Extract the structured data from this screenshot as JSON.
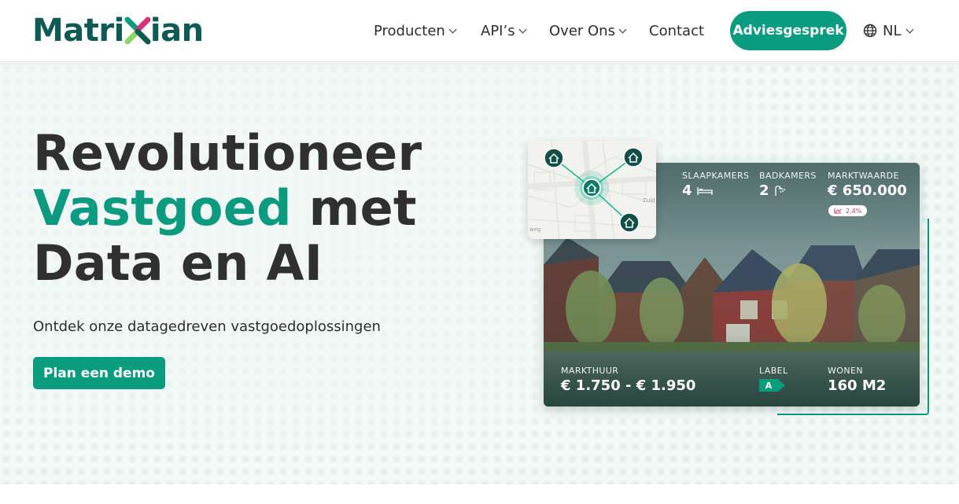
{
  "brand": {
    "logo_left": "Matri",
    "logo_right": "ian",
    "logo_mark": "X",
    "primary_color": "#0a9c7f",
    "dark_color": "#0f5a55"
  },
  "nav": {
    "items": [
      {
        "label": "Producten",
        "has_dropdown": true
      },
      {
        "label": "API’s",
        "has_dropdown": true
      },
      {
        "label": "Over Ons",
        "has_dropdown": true
      },
      {
        "label": "Contact",
        "has_dropdown": false
      }
    ],
    "cta_label": "Adviesgesprek",
    "language": "NL",
    "language_icon": "globe-icon"
  },
  "hero": {
    "headline_line1": "Revolutioneer",
    "headline_accent": "Vastgoed",
    "headline_line2_rest": " met",
    "headline_line3": "Data en AI",
    "subtitle": "Ontdek onze datagedreven vastgoedoplossingen",
    "button_label": "Plan een demo"
  },
  "property": {
    "bedrooms_label": "SLAAPKAMERS",
    "bedrooms_value": "4",
    "bathrooms_label": "BADKAMERS",
    "bathrooms_value": "2",
    "market_value_label": "MARKTWAARDE",
    "market_value": "€ 650.000",
    "market_change": "2,4%",
    "rent_label": "MARKTHUUR",
    "rent_value": "€ 1.750 - € 1.950",
    "energy_label_title": "LABEL",
    "energy_label": "A",
    "living_label": "WONEN",
    "living_value": "160 M2"
  },
  "map": {
    "street_1": "Zuid",
    "street_2": "weg"
  }
}
